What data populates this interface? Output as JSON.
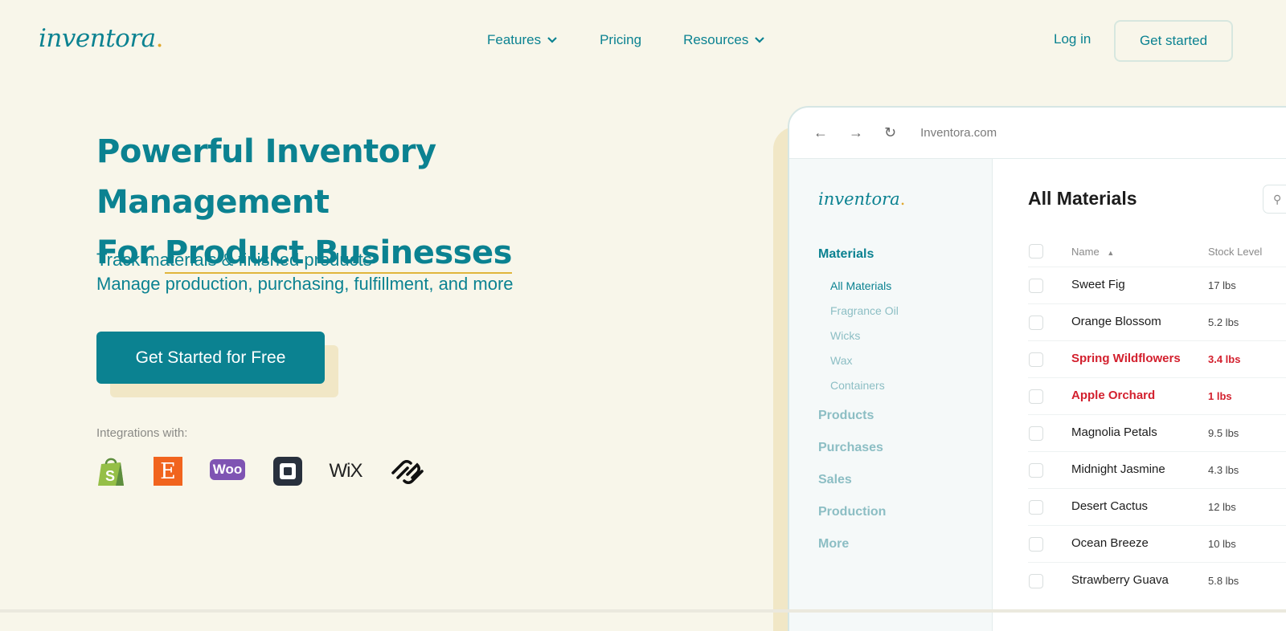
{
  "brand": {
    "logo_text": "inventora",
    "logo_dot": "."
  },
  "nav": {
    "items": [
      {
        "label": "Features",
        "has_dropdown": true
      },
      {
        "label": "Pricing",
        "has_dropdown": false
      },
      {
        "label": "Resources",
        "has_dropdown": true
      }
    ],
    "login_label": "Log in",
    "get_started_label": "Get started"
  },
  "hero": {
    "title_line1": "Powerful Inventory Management",
    "title_line2_prefix": "For",
    "title_line2_highlight": "Product Businesses",
    "subtitle_line1": "Track materials & finished products",
    "subtitle_line2": "Manage production, purchasing, fulfillment, and more",
    "cta_label": "Get Started for Free",
    "integrations_label": "Integrations with:",
    "integrations": [
      {
        "name": "Shopify",
        "icon": "shopify-icon",
        "color": "#95bf47"
      },
      {
        "name": "Etsy",
        "icon": "etsy-icon",
        "color": "#f1641e",
        "glyph": "E"
      },
      {
        "name": "WooCommerce",
        "icon": "woocommerce-icon",
        "color": "#7f54b3",
        "glyph": "Woo"
      },
      {
        "name": "Square",
        "icon": "square-icon",
        "color": "#28303d"
      },
      {
        "name": "Wix",
        "icon": "wix-icon",
        "color": "#222222",
        "glyph": "WiX"
      },
      {
        "name": "Squarespace",
        "icon": "squarespace-icon",
        "color": "#111111"
      }
    ]
  },
  "app_preview": {
    "url": "Inventora.com",
    "sidebar": {
      "logo_text": "inventora",
      "logo_dot": ".",
      "sections": [
        {
          "label": "Materials",
          "active": true
        },
        {
          "label": "Products"
        },
        {
          "label": "Purchases"
        },
        {
          "label": "Sales"
        },
        {
          "label": "Production"
        },
        {
          "label": "More"
        }
      ],
      "material_subitems": [
        "All Materials",
        "Fragrance Oil",
        "Wicks",
        "Wax",
        "Containers"
      ]
    },
    "page_title": "All Materials",
    "table": {
      "columns": [
        "Name",
        "Stock Level"
      ],
      "sort_indicator": "▲",
      "rows": [
        {
          "name": "Sweet Fig",
          "stock": "17 lbs",
          "low": false
        },
        {
          "name": "Orange Blossom",
          "stock": "5.2 lbs",
          "low": false
        },
        {
          "name": "Spring Wildflowers",
          "stock": "3.4 lbs",
          "low": true
        },
        {
          "name": "Apple Orchard",
          "stock": "1 lbs",
          "low": true
        },
        {
          "name": "Magnolia Petals",
          "stock": "9.5 lbs",
          "low": false
        },
        {
          "name": "Midnight Jasmine",
          "stock": "4.3 lbs",
          "low": false
        },
        {
          "name": "Desert Cactus",
          "stock": "12 lbs",
          "low": false
        },
        {
          "name": "Ocean Breeze",
          "stock": "10 lbs",
          "low": false
        },
        {
          "name": "Strawberry Guava",
          "stock": "5.8 lbs",
          "low": false
        }
      ]
    }
  },
  "colors": {
    "primary": "#0b8291",
    "accent": "#e0a82e",
    "background": "#f8f6ea",
    "warning": "#d3202e"
  }
}
